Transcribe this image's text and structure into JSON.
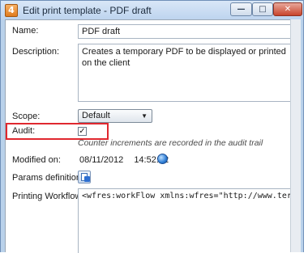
{
  "window": {
    "title": "Edit print template - PDF draft",
    "app_icon_glyph": "4"
  },
  "form": {
    "name": {
      "label": "Name:",
      "value": "PDF draft"
    },
    "description": {
      "label": "Description:",
      "value": "Creates a temporary PDF to be displayed or printed on the client"
    },
    "scope": {
      "label": "Scope:",
      "selected": "Default",
      "arrow": "▼"
    },
    "audit": {
      "label": "Audit:",
      "checked": true,
      "check_glyph": "✓",
      "hint": "Counter increments are recorded in the audit trail"
    },
    "modified": {
      "label": "Modified on:",
      "date": "08/11/2012",
      "time": "14:52:32"
    },
    "params": {
      "label": "Params definition:"
    },
    "workflow": {
      "label": "Printing Workflow:",
      "value": "<wfres:workFlow xmlns:wfres=\"http://www.teradp.c"
    }
  },
  "icons": {
    "app": "app-icon",
    "minimize": "minimize-icon",
    "maximize": "maximize-icon",
    "close": "close-icon",
    "globe": "globe-icon",
    "params": "params-definition-icon"
  },
  "colors": {
    "highlight_box": "#e0282f",
    "title_bar": "#bcd3ee"
  }
}
